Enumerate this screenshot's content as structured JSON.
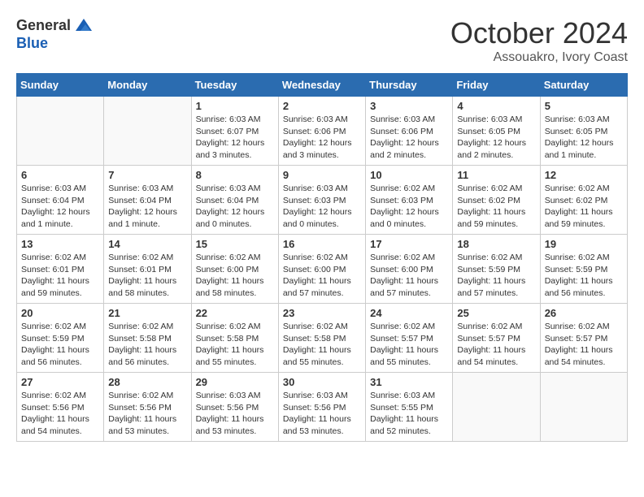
{
  "logo": {
    "general": "General",
    "blue": "Blue"
  },
  "title": {
    "month": "October 2024",
    "location": "Assouakro, Ivory Coast"
  },
  "headers": [
    "Sunday",
    "Monday",
    "Tuesday",
    "Wednesday",
    "Thursday",
    "Friday",
    "Saturday"
  ],
  "weeks": [
    [
      {
        "day": "",
        "info": ""
      },
      {
        "day": "",
        "info": ""
      },
      {
        "day": "1",
        "info": "Sunrise: 6:03 AM\nSunset: 6:07 PM\nDaylight: 12 hours and 3 minutes."
      },
      {
        "day": "2",
        "info": "Sunrise: 6:03 AM\nSunset: 6:06 PM\nDaylight: 12 hours and 3 minutes."
      },
      {
        "day": "3",
        "info": "Sunrise: 6:03 AM\nSunset: 6:06 PM\nDaylight: 12 hours and 2 minutes."
      },
      {
        "day": "4",
        "info": "Sunrise: 6:03 AM\nSunset: 6:05 PM\nDaylight: 12 hours and 2 minutes."
      },
      {
        "day": "5",
        "info": "Sunrise: 6:03 AM\nSunset: 6:05 PM\nDaylight: 12 hours and 1 minute."
      }
    ],
    [
      {
        "day": "6",
        "info": "Sunrise: 6:03 AM\nSunset: 6:04 PM\nDaylight: 12 hours and 1 minute."
      },
      {
        "day": "7",
        "info": "Sunrise: 6:03 AM\nSunset: 6:04 PM\nDaylight: 12 hours and 1 minute."
      },
      {
        "day": "8",
        "info": "Sunrise: 6:03 AM\nSunset: 6:04 PM\nDaylight: 12 hours and 0 minutes."
      },
      {
        "day": "9",
        "info": "Sunrise: 6:03 AM\nSunset: 6:03 PM\nDaylight: 12 hours and 0 minutes."
      },
      {
        "day": "10",
        "info": "Sunrise: 6:02 AM\nSunset: 6:03 PM\nDaylight: 12 hours and 0 minutes."
      },
      {
        "day": "11",
        "info": "Sunrise: 6:02 AM\nSunset: 6:02 PM\nDaylight: 11 hours and 59 minutes."
      },
      {
        "day": "12",
        "info": "Sunrise: 6:02 AM\nSunset: 6:02 PM\nDaylight: 11 hours and 59 minutes."
      }
    ],
    [
      {
        "day": "13",
        "info": "Sunrise: 6:02 AM\nSunset: 6:01 PM\nDaylight: 11 hours and 59 minutes."
      },
      {
        "day": "14",
        "info": "Sunrise: 6:02 AM\nSunset: 6:01 PM\nDaylight: 11 hours and 58 minutes."
      },
      {
        "day": "15",
        "info": "Sunrise: 6:02 AM\nSunset: 6:00 PM\nDaylight: 11 hours and 58 minutes."
      },
      {
        "day": "16",
        "info": "Sunrise: 6:02 AM\nSunset: 6:00 PM\nDaylight: 11 hours and 57 minutes."
      },
      {
        "day": "17",
        "info": "Sunrise: 6:02 AM\nSunset: 6:00 PM\nDaylight: 11 hours and 57 minutes."
      },
      {
        "day": "18",
        "info": "Sunrise: 6:02 AM\nSunset: 5:59 PM\nDaylight: 11 hours and 57 minutes."
      },
      {
        "day": "19",
        "info": "Sunrise: 6:02 AM\nSunset: 5:59 PM\nDaylight: 11 hours and 56 minutes."
      }
    ],
    [
      {
        "day": "20",
        "info": "Sunrise: 6:02 AM\nSunset: 5:59 PM\nDaylight: 11 hours and 56 minutes."
      },
      {
        "day": "21",
        "info": "Sunrise: 6:02 AM\nSunset: 5:58 PM\nDaylight: 11 hours and 56 minutes."
      },
      {
        "day": "22",
        "info": "Sunrise: 6:02 AM\nSunset: 5:58 PM\nDaylight: 11 hours and 55 minutes."
      },
      {
        "day": "23",
        "info": "Sunrise: 6:02 AM\nSunset: 5:58 PM\nDaylight: 11 hours and 55 minutes."
      },
      {
        "day": "24",
        "info": "Sunrise: 6:02 AM\nSunset: 5:57 PM\nDaylight: 11 hours and 55 minutes."
      },
      {
        "day": "25",
        "info": "Sunrise: 6:02 AM\nSunset: 5:57 PM\nDaylight: 11 hours and 54 minutes."
      },
      {
        "day": "26",
        "info": "Sunrise: 6:02 AM\nSunset: 5:57 PM\nDaylight: 11 hours and 54 minutes."
      }
    ],
    [
      {
        "day": "27",
        "info": "Sunrise: 6:02 AM\nSunset: 5:56 PM\nDaylight: 11 hours and 54 minutes."
      },
      {
        "day": "28",
        "info": "Sunrise: 6:02 AM\nSunset: 5:56 PM\nDaylight: 11 hours and 53 minutes."
      },
      {
        "day": "29",
        "info": "Sunrise: 6:03 AM\nSunset: 5:56 PM\nDaylight: 11 hours and 53 minutes."
      },
      {
        "day": "30",
        "info": "Sunrise: 6:03 AM\nSunset: 5:56 PM\nDaylight: 11 hours and 53 minutes."
      },
      {
        "day": "31",
        "info": "Sunrise: 6:03 AM\nSunset: 5:55 PM\nDaylight: 11 hours and 52 minutes."
      },
      {
        "day": "",
        "info": ""
      },
      {
        "day": "",
        "info": ""
      }
    ]
  ]
}
